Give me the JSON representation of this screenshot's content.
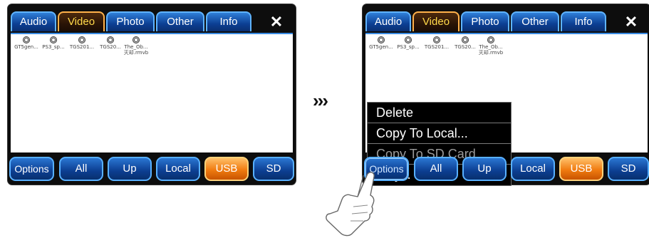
{
  "left_screen": {
    "tabs": [
      {
        "label": "Audio",
        "active": false
      },
      {
        "label": "Video",
        "active": true
      },
      {
        "label": "Photo",
        "active": false
      },
      {
        "label": "Other",
        "active": false
      },
      {
        "label": "Info",
        "active": false
      }
    ],
    "close_label": "✕",
    "files": [
      "GT5gen...",
      "PS3_sp...",
      "TGS201...",
      "TGS20...",
      "The_Ob...\n灭却.rmvb"
    ],
    "buttons": [
      {
        "label": "Options",
        "active": false
      },
      {
        "label": "All",
        "active": false
      },
      {
        "label": "Up",
        "active": false
      },
      {
        "label": "Local",
        "active": false
      },
      {
        "label": "USB",
        "active": true
      },
      {
        "label": "SD",
        "active": false
      }
    ]
  },
  "right_screen": {
    "tabs": [
      {
        "label": "Audio",
        "active": false
      },
      {
        "label": "Video",
        "active": true
      },
      {
        "label": "Photo",
        "active": false
      },
      {
        "label": "Other",
        "active": false
      },
      {
        "label": "Info",
        "active": false
      }
    ],
    "close_label": "✕",
    "files": [
      "GT5gen...",
      "PS3_sp...",
      "TGS201...",
      "TGS20...",
      "The_Ob...\n灭却.rmvb"
    ],
    "context_menu": [
      {
        "label": "Delete",
        "enabled": true
      },
      {
        "label": "Copy To Local...",
        "enabled": true
      },
      {
        "label": "Copy To SD Card...",
        "enabled": false
      },
      {
        "label": "Play...",
        "enabled": true
      }
    ],
    "buttons": [
      {
        "label": "Options",
        "active": false
      },
      {
        "label": "All",
        "active": false
      },
      {
        "label": "Up",
        "active": false
      },
      {
        "label": "Local",
        "active": false
      },
      {
        "label": "USB",
        "active": true
      },
      {
        "label": "SD",
        "active": false
      }
    ]
  },
  "transition_arrows": "›››",
  "colors": {
    "tab_blue": "#0c3f93",
    "active_tab_text": "#ffd94a",
    "active_button_orange": "#f07b10",
    "border_blue": "#5fb3ff"
  },
  "icons": [
    "video-file-icon",
    "close-icon",
    "pointing-hand-icon"
  ]
}
